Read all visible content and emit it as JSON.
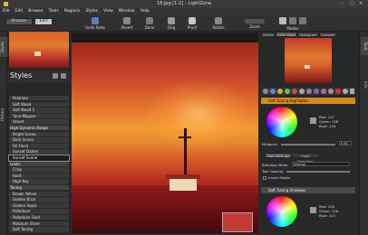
{
  "window": {
    "title": "18.jpg [1:2] – LightZone"
  },
  "menu": [
    "File",
    "Edit",
    "Browse",
    "Tools",
    "Regions",
    "Styles",
    "View",
    "Window",
    "Help"
  ],
  "modes": {
    "browse": "Browse",
    "edit": "Edit"
  },
  "toolbar": {
    "undo": "Undo Redo",
    "revert": "Revert",
    "done": "Done",
    "orig": "Orig",
    "proof": "Proof",
    "rotate": "Rotate",
    "zoom": "Zoom",
    "modes": "Modes"
  },
  "left_tabs": {
    "styles": "Styles",
    "history": "History"
  },
  "styles": {
    "title": "Styles",
    "items": [
      {
        "label": "Polarizer",
        "type": "item"
      },
      {
        "label": "Soft Wood",
        "type": "item"
      },
      {
        "label": "Soft Wood 1",
        "type": "item"
      },
      {
        "label": "Tone Mapper",
        "type": "item"
      },
      {
        "label": "Velvet",
        "type": "item"
      },
      {
        "label": "High Dynamic Range",
        "type": "cat"
      },
      {
        "label": "Bright Scene",
        "type": "item"
      },
      {
        "label": "Dark Scene",
        "type": "item"
      },
      {
        "label": "Fill Flash",
        "type": "item"
      },
      {
        "label": "Sunset Darker",
        "type": "item"
      },
      {
        "label": "Sunset Scene",
        "type": "sel"
      },
      {
        "label": "Looks",
        "type": "cat"
      },
      {
        "label": "Crisp",
        "type": "item"
      },
      {
        "label": "Hard",
        "type": "item"
      },
      {
        "label": "High Key",
        "type": "item"
      },
      {
        "label": "Toning",
        "type": "cat"
      },
      {
        "label": "Brown Yellow",
        "type": "item"
      },
      {
        "label": "Golden Brick",
        "type": "item"
      },
      {
        "label": "Golden Sepia",
        "type": "item"
      },
      {
        "label": "Palladium",
        "type": "item"
      },
      {
        "label": "Palladium Gold",
        "type": "item"
      },
      {
        "label": "Platinum Silver",
        "type": "item"
      },
      {
        "label": "Soft Toning",
        "type": "item"
      }
    ]
  },
  "right_tabs_top": [
    "Zones",
    "Color Mask",
    "Histogram",
    "Sampler"
  ],
  "right_vtabs": {
    "tools": "Tools",
    "info": "Info"
  },
  "tool1": {
    "title": "Soft Tuning Highlights",
    "red": "Red: 127",
    "green": "Green: 128",
    "blue": "Blue: 116",
    "midpoint_label": "Midpoint:",
    "midpoint": "0.61",
    "tab1": "Tool Settings",
    "tab2": "Color Selection",
    "blend_label": "Blending Mode:",
    "blend": "Normal",
    "opacity_label": "Tool Opacity:",
    "invert": "Invert Masks"
  },
  "tool2": {
    "title": "Soft Tuning Shadows",
    "red": "Red: 128",
    "green": "Green: 128",
    "blue": "Blue: 121"
  }
}
